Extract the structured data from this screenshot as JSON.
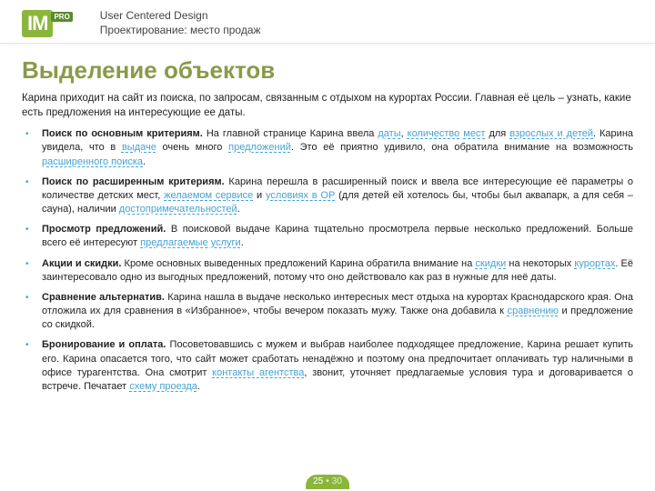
{
  "logo": {
    "main": "IM",
    "badge": "PRO"
  },
  "header": {
    "line1": "User Centered Design",
    "line2": "Проектирование: место продаж"
  },
  "title": "Выделение объектов",
  "subtitle": "Карина приходит на сайт из поиска, по запросам, связанным с отдыхом на курортах России. Главная её цель – узнать, какие есть предложения на интересующие ее даты.",
  "bullets": {
    "b1": {
      "h": "Поиск по основным критериям.",
      "t0": " На главной странице Карина ввела ",
      "u1": "даты",
      "t1": ", ",
      "u2": "количество",
      "t2": " ",
      "u3": "мест",
      "t3": " для ",
      "u4": "взрослых и детей",
      "t4": ". Карина увидела, что в ",
      "u5": "выдаче",
      "t5": " очень много ",
      "u6": "предложений",
      "t6": ". Это её приятно удивило, она обратила внимание на возможность ",
      "u7": "расширенного поиска",
      "t7": "."
    },
    "b2": {
      "h": "Поиск по расширенным критериям.",
      "t0": " Карина перешла в расширенный поиск и ввела все интересующие её параметры о количестве детских мест, ",
      "u1": "желаемом сервисе",
      "t1": " и ",
      "u2": "условиях в ОР",
      "t2": " (для детей ей хотелось бы, чтобы был аквапарк, а для себя – сауна), наличии ",
      "u3": "достопримечательностей",
      "t3": "."
    },
    "b3": {
      "h": "Просмотр предложений.",
      "t0": " В поисковой выдаче Карина тщательно просмотрела первые несколько предложений. Больше всего её интересуют ",
      "u1": "предлагаемые услуги",
      "t1": "."
    },
    "b4": {
      "h": "Акции и скидки.",
      "t0": " Кроме основных выведенных предложений Карина обратила внимание на ",
      "u1": "скидки",
      "t1": " на некоторых ",
      "u2": "курортах",
      "t2": ". Её заинтересовало одно из выгодных предложений, потому что оно действовало как раз в нужные для неё даты."
    },
    "b5": {
      "h": "Сравнение альтернатив.",
      "t0": " Карина нашла в выдаче несколько интересных мест отдыха на курортах Краснодарского края. Она отложила их для сравнения в «Избранное», чтобы вечером показать мужу. Также она добавила к ",
      "u1": "сравнению",
      "t1": " и предложение со скидкой."
    },
    "b6": {
      "h": "Бронирование и оплата.",
      "t0": " Посоветовавшись с мужем и выбрав наиболее подходящее предложение, Карина решает купить его. Карина опасается того, что сайт может сработать ненадёжно и поэтому она предпочитает оплачивать тур наличными в офисе турагентства. Она смотрит ",
      "u1": "контакты агентства",
      "t1": ", звонит, уточняет предлагаемые условия тура и договаривается о встрече. Печатает ",
      "u2": "схему проезда",
      "t2": "."
    }
  },
  "footer": {
    "current": "25",
    "sep": "•",
    "total": "30"
  }
}
